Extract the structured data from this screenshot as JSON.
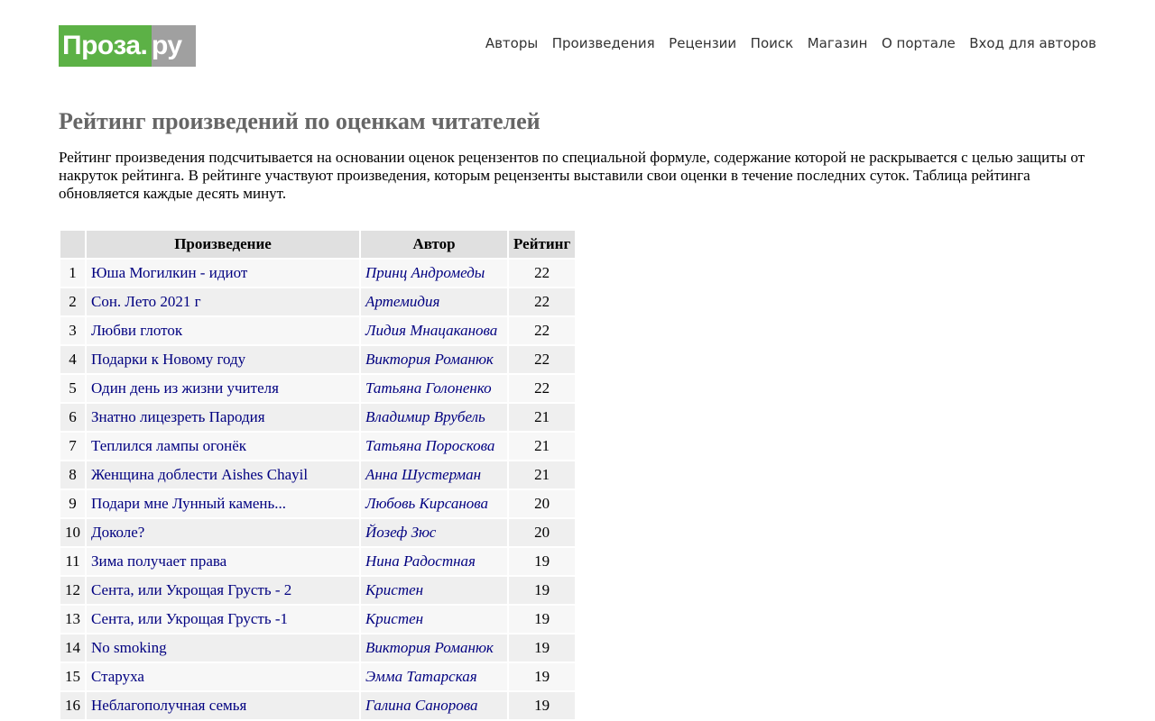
{
  "logo": {
    "main": "Проза",
    "dot": ".",
    "suffix": "ру"
  },
  "nav": [
    {
      "label": "Авторы"
    },
    {
      "label": "Произведения"
    },
    {
      "label": "Рецензии"
    },
    {
      "label": "Поиск"
    },
    {
      "label": "Магазин"
    },
    {
      "label": "О портале"
    },
    {
      "label": "Вход для авторов"
    }
  ],
  "page": {
    "title": "Рейтинг произведений по оценкам читателей",
    "intro": "Рейтинг произведения подсчитывается на основании оценок рецензентов по специальной формуле, содержание которой не раскрывается с целью защиты от накруток рейтинга. В рейтинге участвуют произведения, которым рецензенты выставили свои оценки в течение последних суток. Таблица рейтинга обновляется каждые десять минут."
  },
  "table": {
    "headers": {
      "num": "",
      "work": "Произведение",
      "author": "Автор",
      "rating": "Рейтинг"
    },
    "rows": [
      {
        "num": "1",
        "work": "Юша Могилкин - идиот",
        "author": "Принц Андромеды",
        "rating": "22"
      },
      {
        "num": "2",
        "work": "Сон. Лето 2021 г",
        "author": "Артемидия",
        "rating": "22"
      },
      {
        "num": "3",
        "work": "Любви глоток",
        "author": "Лидия Мнацаканова",
        "rating": "22"
      },
      {
        "num": "4",
        "work": "Подарки к Новому году",
        "author": "Виктория Романюк",
        "rating": "22"
      },
      {
        "num": "5",
        "work": "Один день из жизни учителя",
        "author": "Татьяна Голоненко",
        "rating": "22"
      },
      {
        "num": "6",
        "work": "Знатно лицезреть Пародия",
        "author": "Владимир Врубель",
        "rating": "21"
      },
      {
        "num": "7",
        "work": "Теплился лампы огонёк",
        "author": "Татьяна Пороскова",
        "rating": "21"
      },
      {
        "num": "8",
        "work": "Женщина доблести Aishes Chayil",
        "author": "Анна Шустерман",
        "rating": "21"
      },
      {
        "num": "9",
        "work": "Подари мне Лунный камень...",
        "author": "Любовь Кирсанова",
        "rating": "20"
      },
      {
        "num": "10",
        "work": "Доколе?",
        "author": "Йозеф Зюс",
        "rating": "20"
      },
      {
        "num": "11",
        "work": "Зима получает права",
        "author": "Нина Радостная",
        "rating": "19"
      },
      {
        "num": "12",
        "work": "Сента, или Укрощая Грусть - 2",
        "author": "Кристен",
        "rating": "19"
      },
      {
        "num": "13",
        "work": "Сента, или Укрощая Грусть -1",
        "author": "Кристен",
        "rating": "19"
      },
      {
        "num": "14",
        "work": "No smoking",
        "author": "Виктория Романюк",
        "rating": "19"
      },
      {
        "num": "15",
        "work": "Старуха",
        "author": "Эмма Татарская",
        "rating": "19"
      },
      {
        "num": "16",
        "work": "Неблагополучная семья",
        "author": "Галина Санорова",
        "rating": "19"
      }
    ]
  },
  "colors": {
    "logo_green": "#5cb146",
    "logo_gray": "#a0a0a0",
    "link": "#000080",
    "title": "#666666",
    "header_cell": "#e0e0e0"
  }
}
